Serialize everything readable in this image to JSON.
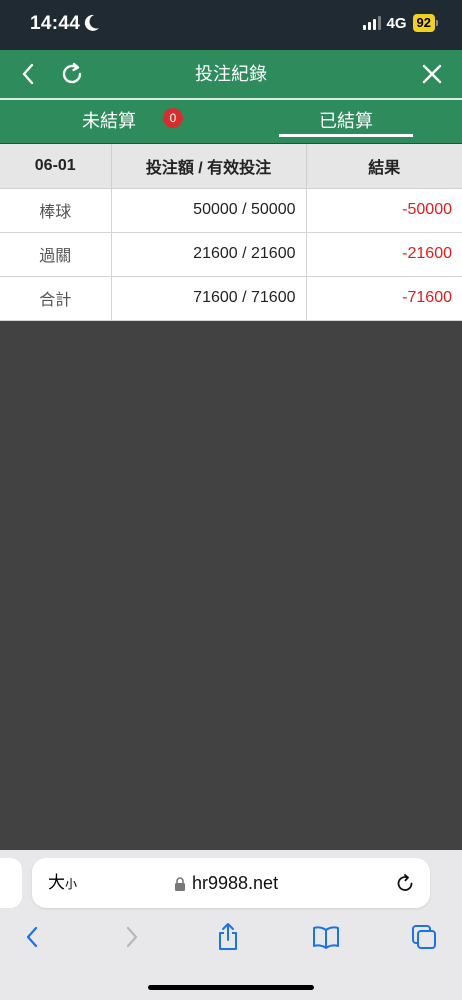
{
  "status_bar": {
    "time": "14:44",
    "network": "4G",
    "battery": "92"
  },
  "header": {
    "title": "投注紀錄"
  },
  "tabs": [
    {
      "label": "未結算",
      "badge": "0"
    },
    {
      "label": "已結算"
    }
  ],
  "table": {
    "headers": [
      "06-01",
      "投注額 / 有效投注",
      "結果"
    ],
    "rows": [
      {
        "type": "棒球",
        "amount": "50000 / 50000",
        "result": "-50000"
      },
      {
        "type": "過關",
        "amount": "21600 / 21600",
        "result": "-21600"
      },
      {
        "type": "合計",
        "amount": "71600 / 71600",
        "result": "-71600"
      }
    ]
  },
  "browser": {
    "text_size_large": "大",
    "text_size_small": "小",
    "url": "hr9988.net"
  },
  "colors": {
    "header_green": "#2e8b5b",
    "badge_red": "#d32f2f",
    "result_red": "#e51a1a",
    "content_bg": "#424242",
    "safari_blue": "#1a73e8"
  },
  "icons": [
    "moon-icon",
    "signal-icon",
    "battery-icon",
    "back-icon",
    "refresh-icon",
    "close-icon",
    "lock-icon",
    "reload-icon",
    "back-arrow-icon",
    "forward-arrow-icon",
    "share-icon",
    "bookmarks-icon",
    "tabs-icon"
  ]
}
